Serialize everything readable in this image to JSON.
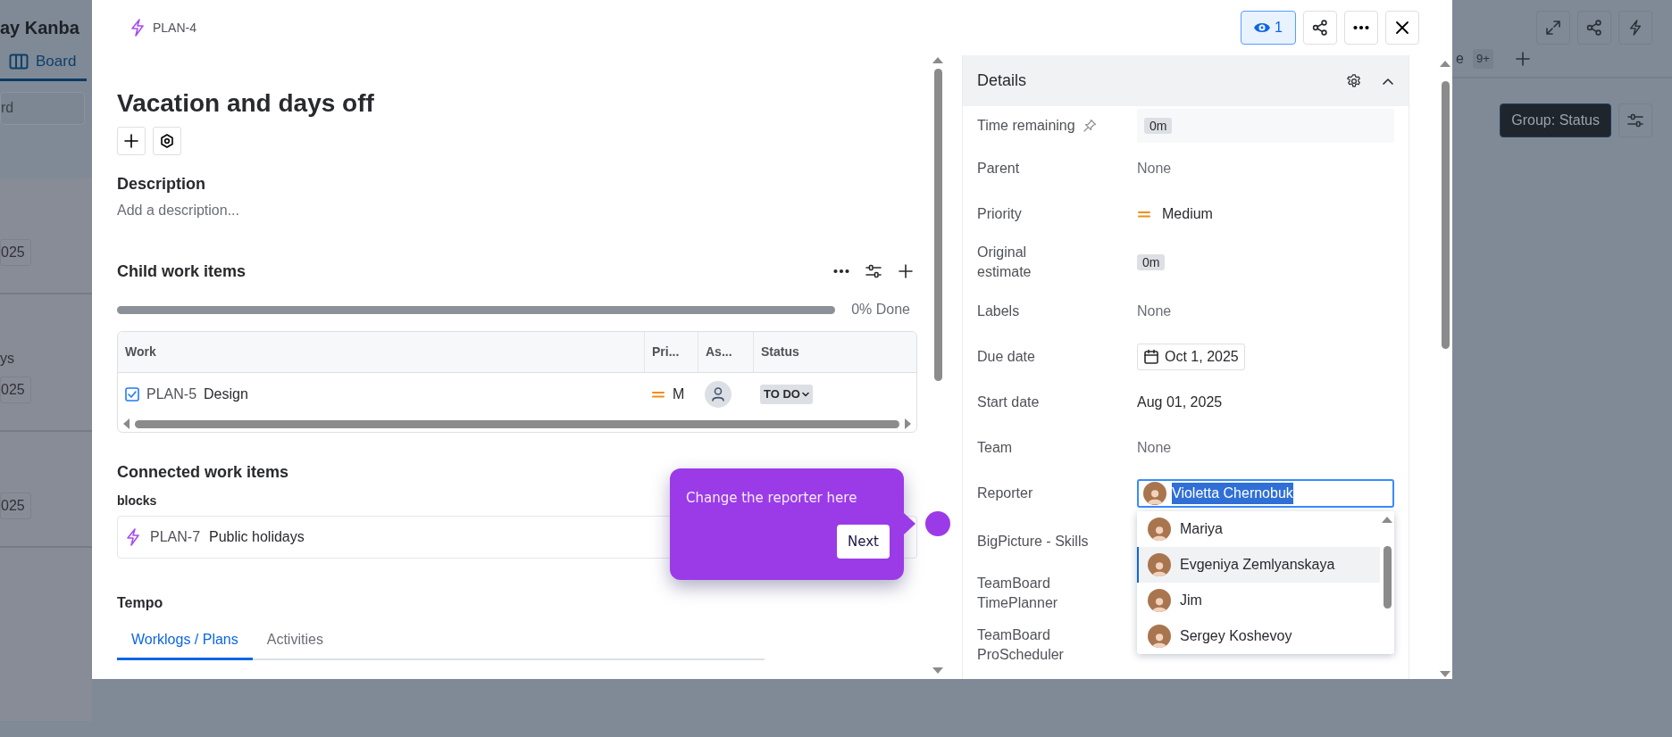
{
  "board": {
    "title": "ay Kanba",
    "tabs": [
      {
        "label": "Board",
        "selected": true
      }
    ],
    "search": {
      "placeholder": "rd"
    },
    "cards": [
      {
        "texts": [
          {
            "kind": "date",
            "text": "025"
          }
        ]
      },
      {
        "texts": [
          {
            "kind": "title",
            "text": "ys"
          },
          {
            "kind": "date",
            "text": "025"
          }
        ]
      },
      {
        "texts": [
          {
            "kind": "date",
            "text": "025"
          }
        ]
      }
    ],
    "view_tab": {
      "label": "e",
      "count": "9+"
    },
    "group_button": "Group: Status"
  },
  "issue": {
    "key": "PLAN-4",
    "kind": "epic",
    "watchers": "1",
    "title": "Vacation and days off",
    "description": {
      "heading": "Description",
      "placeholder": "Add a description..."
    },
    "child_items": {
      "heading": "Child work items",
      "level": 0,
      "progress_text": "0% Done",
      "columns": [
        "Work",
        "Pri...",
        "As...",
        "Status"
      ],
      "rows": [
        {
          "kind": "task",
          "key": "PLAN-5",
          "summary": "Design",
          "priority": "M",
          "status": "TO DO"
        }
      ]
    },
    "connected": {
      "heading": "Connected work items",
      "groups": [
        {
          "relation": "blocks",
          "items": [
            {
              "kind": "epic",
              "key": "PLAN-7",
              "summary": "Public holidays"
            }
          ]
        }
      ]
    },
    "tempo": {
      "heading": "Tempo",
      "tabs": [
        {
          "label": "Worklogs / Plans",
          "selected": true
        },
        {
          "label": "Activities",
          "selected": false
        }
      ]
    },
    "details": {
      "heading": "Details",
      "fields": [
        {
          "label": "Time remaining",
          "kind": "time",
          "value": "0m",
          "pinned": true
        },
        {
          "label": "Parent",
          "kind": "none",
          "value": "None"
        },
        {
          "label": "Priority",
          "kind": "priority",
          "value": "Medium"
        },
        {
          "label": "Original estimate",
          "kind": "time",
          "value": "0m",
          "pinned": false
        },
        {
          "label": "Labels",
          "kind": "none",
          "value": "None"
        },
        {
          "label": "Due date",
          "kind": "date",
          "value": "Oct 1, 2025"
        },
        {
          "label": "Start date",
          "kind": "text",
          "value": "Aug 01, 2025"
        },
        {
          "label": "Team",
          "kind": "none",
          "value": "None"
        },
        {
          "label": "Reporter",
          "kind": "user",
          "value": "Violetta Chernobuk",
          "text_selected": true
        },
        {
          "label": "BigPicture - Skills",
          "kind": "empty"
        },
        {
          "label": "TeamBoard TimePlanner",
          "kind": "empty"
        },
        {
          "label": "TeamBoard ProScheduler",
          "kind": "empty"
        }
      ]
    },
    "reporter_options": [
      {
        "name": "Mariya",
        "selected": false
      },
      {
        "name": "Evgeniya Zemlyanskaya",
        "selected": true
      },
      {
        "name": "Jim",
        "selected": false
      },
      {
        "name": "Sergey Koshevoy",
        "selected": false
      }
    ]
  },
  "tour_tip": {
    "text": "Change the reporter here",
    "button": "Next"
  }
}
